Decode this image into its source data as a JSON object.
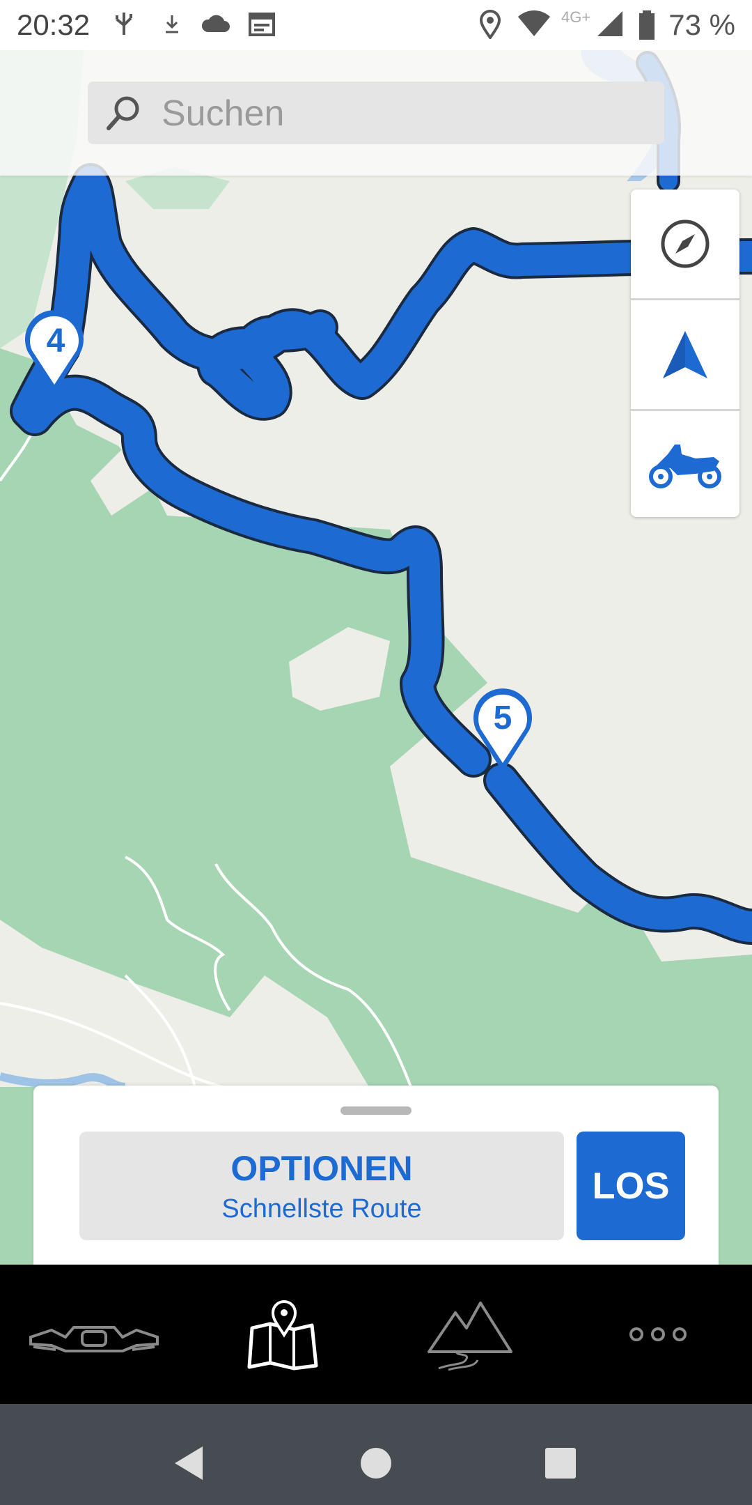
{
  "status_bar": {
    "time": "20:32",
    "network_label": "4G+",
    "battery_percent": "73 %",
    "icons": [
      "usb-icon",
      "download-icon",
      "cloud-icon",
      "calendar-icon",
      "location-icon",
      "wifi-icon",
      "signal-icon",
      "battery-icon"
    ]
  },
  "search": {
    "placeholder": "Suchen"
  },
  "map": {
    "route_color": "#1e6ad3",
    "waypoints": [
      {
        "label": "4"
      },
      {
        "label": "5"
      }
    ]
  },
  "map_controls": {
    "items": [
      "compass-icon",
      "navigation-arrow-icon",
      "motorcycle-icon"
    ]
  },
  "route_panel": {
    "options_title": "OPTIONEN",
    "options_subtitle": "Schnellste Route",
    "go_label": "LOS"
  },
  "bottom_nav": {
    "items": [
      {
        "icon": "motorcycle-cockpit-icon",
        "active": false
      },
      {
        "icon": "map-pin-icon",
        "active": true
      },
      {
        "icon": "mountains-road-icon",
        "active": false
      },
      {
        "icon": "more-dots-icon",
        "active": false
      }
    ]
  },
  "system_nav": {
    "items": [
      "back-icon",
      "home-icon",
      "recents-icon"
    ]
  },
  "colors": {
    "accent": "#1e6ad3",
    "forest": "#a5d5b3",
    "land": "#eeeee9",
    "nav_background": "#000000",
    "system_nav_background": "#464c52"
  }
}
